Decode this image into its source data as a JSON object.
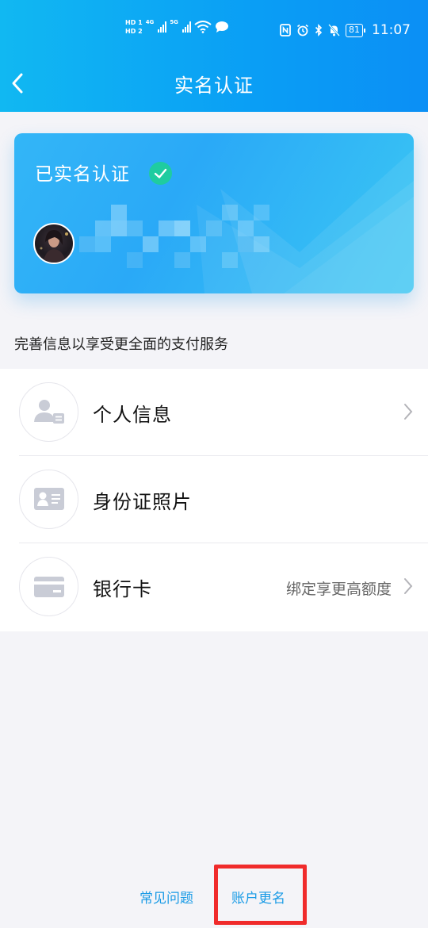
{
  "status_bar": {
    "hd1": "HD 1",
    "hd2": "HD 2",
    "net1": "4G",
    "net2": "5G",
    "battery": "81",
    "time": "11:07"
  },
  "nav": {
    "title": "实名认证"
  },
  "card": {
    "verified_label": "已实名认证"
  },
  "section_caption": "完善信息以享受更全面的支付服务",
  "items": [
    {
      "label": "个人信息",
      "hint": "",
      "has_chevron": true
    },
    {
      "label": "身份证照片",
      "hint": "",
      "has_chevron": false
    },
    {
      "label": "银行卡",
      "hint": "绑定享更高额度",
      "has_chevron": true
    }
  ],
  "footer": {
    "faq": "常见问题",
    "rename": "账户更名"
  },
  "colors": {
    "header": "#0a9ef5",
    "accent_link": "#1a9be6",
    "verified_check": "#1fcca0",
    "highlight_frame": "#f02b2b"
  }
}
